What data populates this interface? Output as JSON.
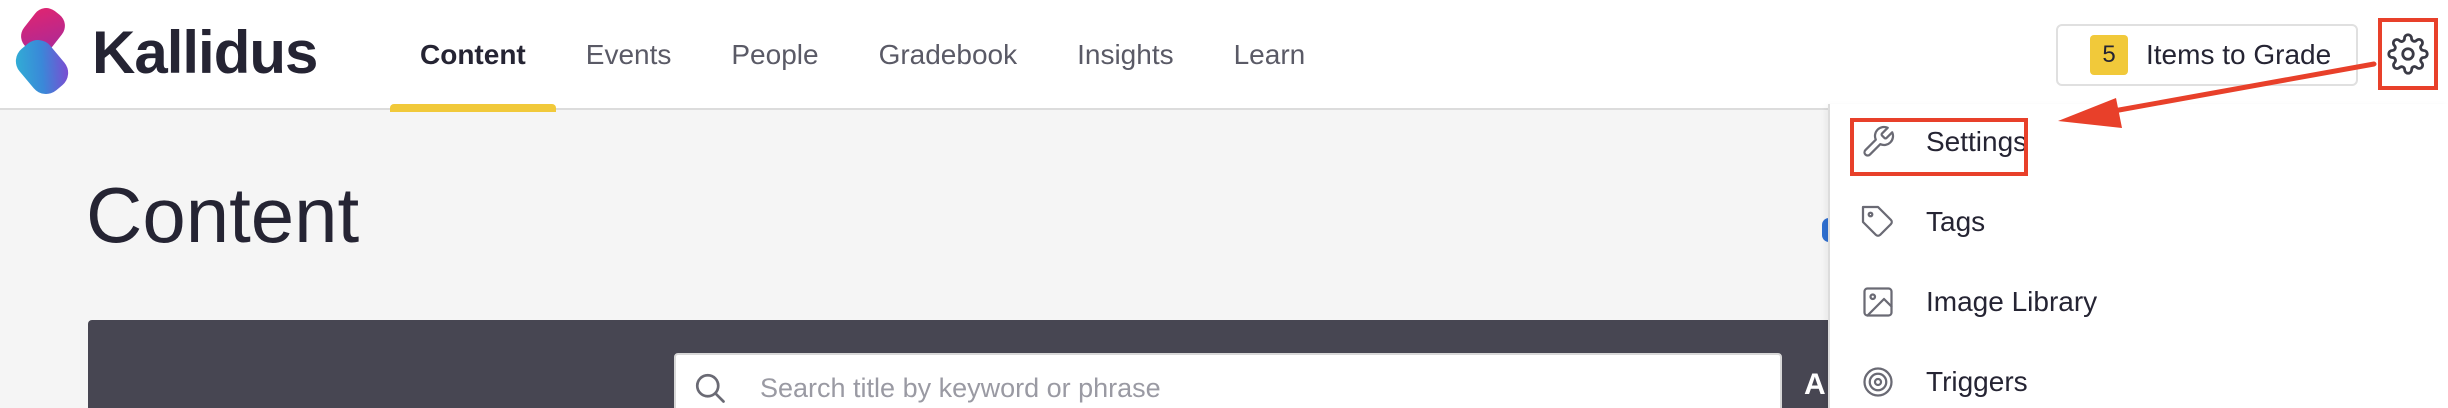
{
  "brand": {
    "name": "Kallidus",
    "accent": "#f1c93a",
    "highlight": "#e8402a"
  },
  "nav": {
    "items": [
      {
        "label": "Content",
        "active": true
      },
      {
        "label": "Events",
        "active": false
      },
      {
        "label": "People",
        "active": false
      },
      {
        "label": "Gradebook",
        "active": false
      },
      {
        "label": "Insights",
        "active": false
      },
      {
        "label": "Learn",
        "active": false
      }
    ]
  },
  "header": {
    "grade_count": "5",
    "grade_label": "Items to Grade",
    "gear_icon": "gear-icon"
  },
  "main": {
    "title": "Content",
    "search_placeholder": "Search title by keyword or phrase",
    "panel_cut_label": "A"
  },
  "menu": {
    "items": [
      {
        "label": "Settings",
        "icon": "wrench-icon"
      },
      {
        "label": "Tags",
        "icon": "tag-icon"
      },
      {
        "label": "Image Library",
        "icon": "image-icon"
      },
      {
        "label": "Triggers",
        "icon": "target-icon"
      }
    ]
  }
}
